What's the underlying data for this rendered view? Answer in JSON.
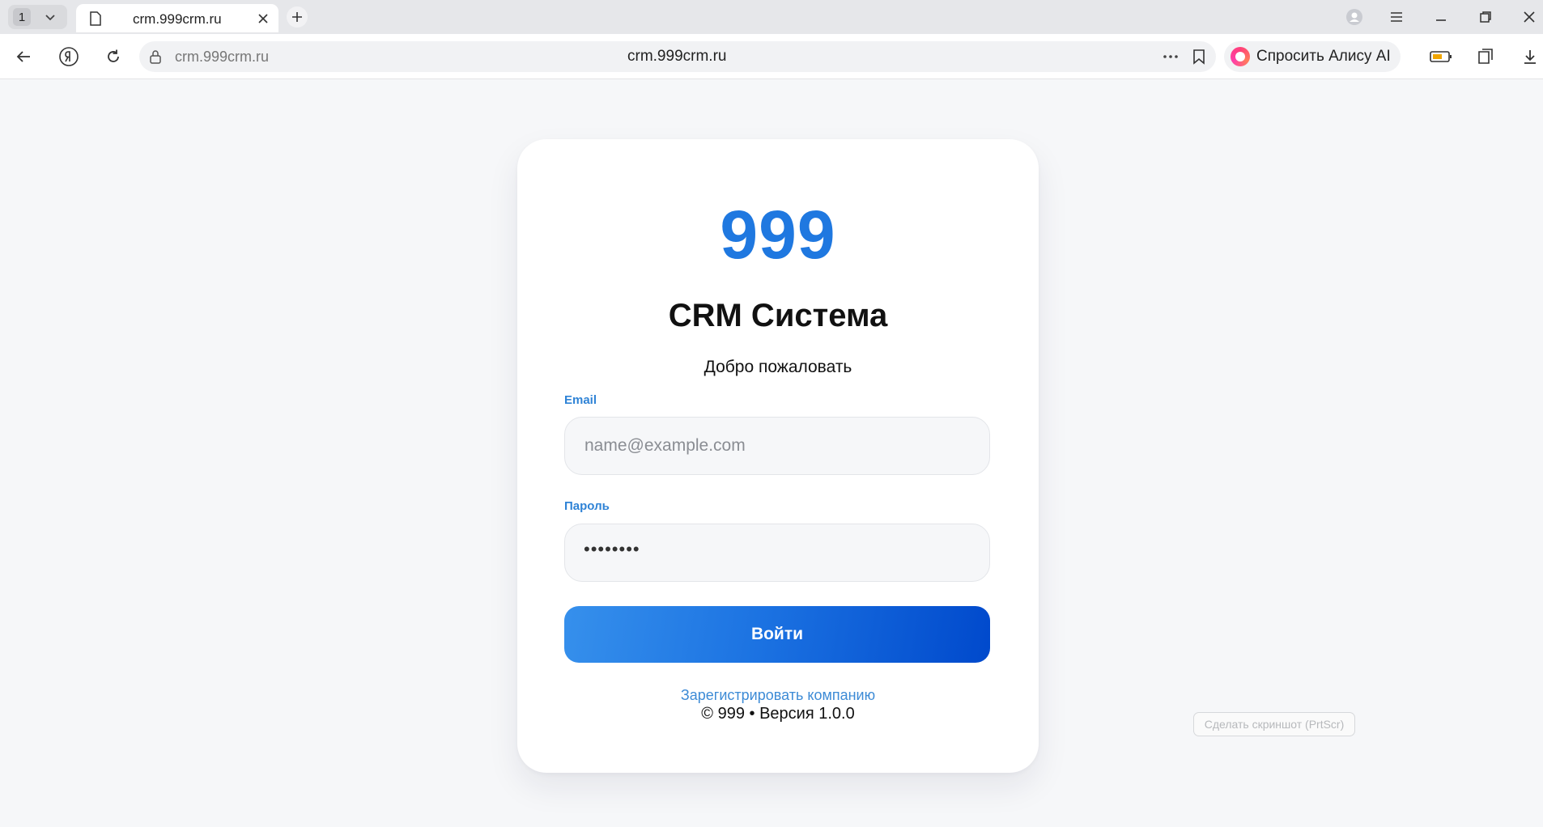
{
  "browser": {
    "tab_count": "1",
    "tab_title": "crm.999crm.ru",
    "url_left": "crm.999crm.ru",
    "url_center": "crm.999crm.ru",
    "alice_label": "Спросить Алису AI",
    "screenshot_hint": "Сделать скриншот (PrtScr)"
  },
  "login": {
    "logo": "999",
    "title": "CRM Система",
    "subtitle": "Добро пожаловать",
    "email_label": "Email",
    "email_placeholder": "name@example.com",
    "password_label": "Пароль",
    "password_masked": "••••••••",
    "submit_label": "Войти",
    "register_link": "Зарегистрировать компанию",
    "footer": "© 999 • Версия 1.0.0"
  },
  "colors": {
    "accent": "#1f78e0",
    "label_blue": "#2f83d6",
    "button_gradient_start": "#3690ec",
    "button_gradient_end": "#0049cc"
  }
}
